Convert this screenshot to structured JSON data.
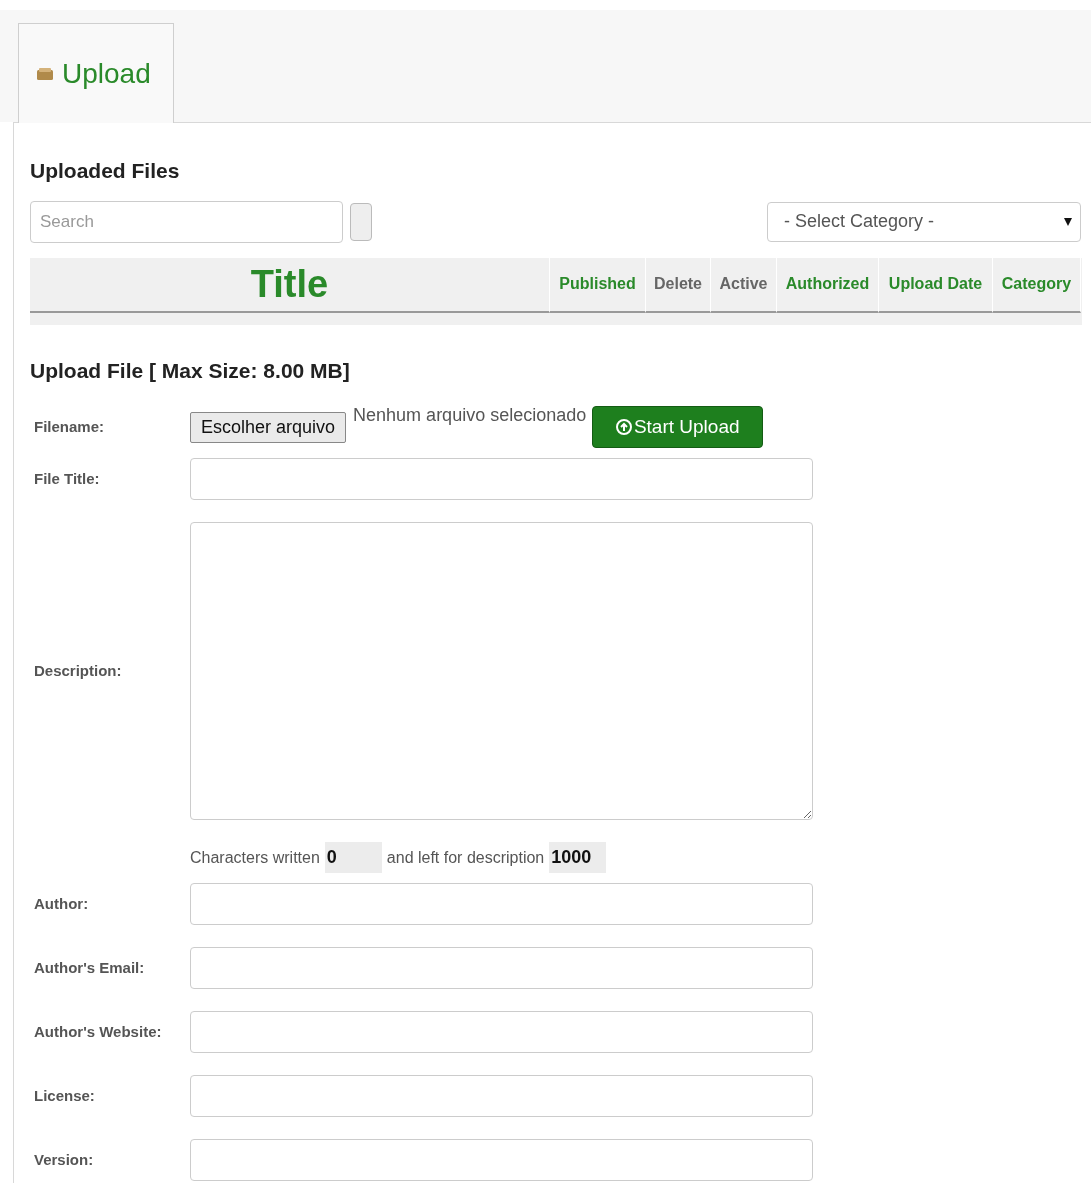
{
  "tabs": [
    {
      "label": "Upload",
      "selected": true
    }
  ],
  "uploaded_files": {
    "heading": "Uploaded Files",
    "search": {
      "placeholder": "Search"
    },
    "category_select": {
      "value": "- Select Category -"
    },
    "table": {
      "columns": [
        {
          "label": "Title",
          "kind": "link"
        },
        {
          "label": "Published",
          "kind": "link"
        },
        {
          "label": "Delete",
          "kind": "text"
        },
        {
          "label": "Active",
          "kind": "text"
        },
        {
          "label": "Authorized",
          "kind": "link"
        },
        {
          "label": "Upload Date",
          "kind": "link"
        },
        {
          "label": "Category",
          "kind": "link"
        }
      ]
    }
  },
  "upload_form": {
    "heading": "Upload File [ Max Size: 8.00 MB]",
    "filename": {
      "label": "Filename:",
      "choose_button": "Escolher arquivo",
      "status": "Nenhum arquivo selecionado",
      "upload_button": "Start Upload"
    },
    "fields": [
      {
        "label": "File Title:",
        "kind": "input"
      },
      {
        "label": "Description:",
        "kind": "textarea",
        "counter": {
          "written_label": "Characters written",
          "written_value": "0",
          "left_label": "and left for description",
          "left_value": "1000"
        }
      },
      {
        "label": "Author:",
        "kind": "input"
      },
      {
        "label": "Author's Email:",
        "kind": "input"
      },
      {
        "label": "Author's Website:",
        "kind": "input"
      },
      {
        "label": "License:",
        "kind": "input"
      },
      {
        "label": "Version:",
        "kind": "input"
      }
    ]
  }
}
